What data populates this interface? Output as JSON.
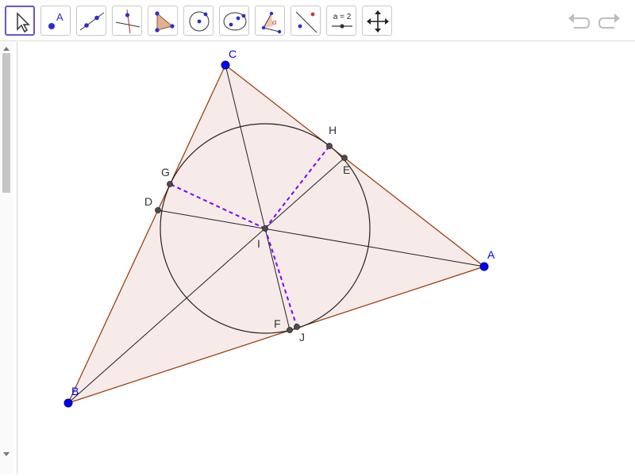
{
  "toolbar": {
    "tools": [
      {
        "name": "move-tool",
        "icon": "arrow-cursor-icon",
        "active": true
      },
      {
        "name": "point-tool",
        "icon": "point-icon",
        "icon_text": "A"
      },
      {
        "name": "line-tool",
        "icon": "line-through-points-icon"
      },
      {
        "name": "perpendicular-line-tool",
        "icon": "perpendicular-line-icon"
      },
      {
        "name": "polygon-tool",
        "icon": "polygon-icon"
      },
      {
        "name": "circle-center-point-tool",
        "icon": "circle-center-point-icon"
      },
      {
        "name": "ellipse-tool",
        "icon": "ellipse-icon"
      },
      {
        "name": "angle-tool",
        "icon": "angle-icon",
        "icon_text": "α"
      },
      {
        "name": "reflect-tool",
        "icon": "reflect-about-line-icon"
      },
      {
        "name": "slider-tool",
        "icon": "slider-icon",
        "icon_text": "a = 2"
      },
      {
        "name": "move-graphics-view-tool",
        "icon": "move-arrows-icon"
      }
    ],
    "undo_icon": "undo-icon",
    "redo_icon": "redo-icon"
  },
  "construction": {
    "point_color": "#0000ff",
    "aux_point_color": "#444444",
    "triangle_stroke": "#993300",
    "triangle_fill": "#f3e4e0",
    "dash_color": "#8000ff",
    "labels": {
      "A": "A",
      "B": "B",
      "C": "C",
      "D": "D",
      "E": "E",
      "F": "F",
      "G": "G",
      "H": "H",
      "I": "I",
      "J": "J"
    }
  }
}
